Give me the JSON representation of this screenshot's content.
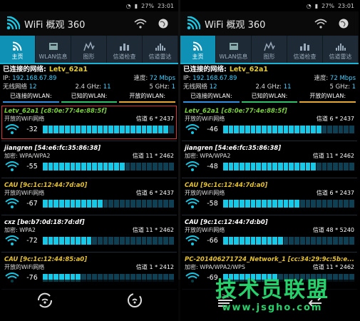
{
  "status": {
    "battery": "27%",
    "time": "23:01"
  },
  "app": {
    "title": "WiFi 概观 360"
  },
  "tabs": [
    "主页",
    "WLAN信息",
    "图形",
    "信道检查",
    "信道雷达"
  ],
  "summary": {
    "connected_label": "已连接的网络:",
    "ssid": "Letv_62a1",
    "ip_label": "IP:",
    "ip": "192.168.67.89",
    "speed_label": "速度:",
    "speed": "72 Mbps",
    "wireless_label": "无线网络",
    "wireless_count": "12",
    "ghz24_label": "2.4 GHz:",
    "ghz24": "11",
    "ghz5_label": "5 GHz:",
    "ghz5": "1",
    "tags": [
      "已连接的WLAN:",
      "已知的WLAN:",
      "开放的WLAN:"
    ]
  },
  "left_networks": [
    {
      "name": "Letv_62a1 [c8:0e:77:4e:88:5f]",
      "sec": "开放的WiFi网络",
      "channel": "信道 6 * 2437",
      "rssi": "-32",
      "level": 0.95
    },
    {
      "name": "jiangren [54:e6:fc:35:86:38]",
      "sec": "加密:   WPA/WPA2",
      "channel": "信道 11 * 2462",
      "rssi": "-55",
      "level": 0.62
    },
    {
      "name": "CAU [9c:1c:12:44:7d:a0]",
      "sec": "开放的WiFi网络",
      "channel": "信道 6 * 2437",
      "rssi": "-67",
      "level": 0.45
    },
    {
      "name": "cxz [be:b7:0d:18:7d:df]",
      "sec": "加密:   WPA2",
      "channel": "信道 11 * 2462",
      "rssi": "-72",
      "level": 0.38
    },
    {
      "name": "CAU [9c:1c:12:44:85:a0]",
      "sec": "开放的WiFi网络",
      "channel": "信道 1 * 2412",
      "rssi": "-76",
      "level": 0.3
    }
  ],
  "right_networks": [
    {
      "name": "Letv_62a1 [c8:0e:77:4e:88:5f]",
      "sec": "开放的WiFi网络",
      "channel": "信道 6 * 2437",
      "rssi": "-46",
      "level": 0.75
    },
    {
      "name": "jiangren [54:e6:fc:35:86:38]",
      "sec": "加密:   WPA/WPA2",
      "channel": "信道 11 * 2462",
      "rssi": "-48",
      "level": 0.72
    },
    {
      "name": "CAU [9c:1c:12:44:7d:a0]",
      "sec": "开放的WiFi网络",
      "channel": "信道 6 * 2437",
      "rssi": "-58",
      "level": 0.57
    },
    {
      "name": "CAU [9c:1c:12:44:7d:b0]",
      "sec": "开放的WiFi网络",
      "channel": "信道 48 * 5240",
      "rssi": "-66",
      "level": 0.47
    },
    {
      "name": "PC-201406271724_Network_1 [cc:34:29:9c:5b:e...",
      "sec": "加密:   WPA/WPA2/WPS",
      "channel": "信道 11 * 2462",
      "rssi": "-69",
      "level": 0.4
    }
  ],
  "footer": [
    "refresh-wifi-icon",
    "auto-refresh-icon",
    "sort-az-icon",
    "swap-icon"
  ],
  "watermark": {
    "main": "技术员联盟",
    "url": "www.jsgho.com"
  }
}
